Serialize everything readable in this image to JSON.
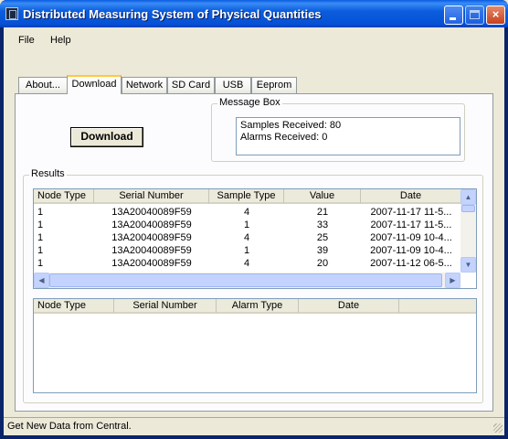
{
  "window": {
    "title": "Distributed Measuring System of Physical Quantities",
    "minimize_glyph": "",
    "close_glyph": "×"
  },
  "menu": [
    {
      "label": "File"
    },
    {
      "label": "Help"
    }
  ],
  "tabs": [
    {
      "label": "About..."
    },
    {
      "label": "Download",
      "active": true
    },
    {
      "label": "Network"
    },
    {
      "label": "SD Card"
    },
    {
      "label": "USB"
    },
    {
      "label": "Eeprom"
    }
  ],
  "download": {
    "button_label": "Download"
  },
  "message_box": {
    "label": "Message Box",
    "lines": [
      "Samples Received: 80",
      "Alarms Received: 0"
    ]
  },
  "results": {
    "label": "Results",
    "samples_table": {
      "columns": [
        "Node Type",
        "Serial Number",
        "Sample Type",
        "Value",
        "Date"
      ],
      "rows": [
        [
          "1",
          "13A20040089F59",
          "4",
          "21",
          "2007-11-17 11-5..."
        ],
        [
          "1",
          "13A20040089F59",
          "1",
          "33",
          "2007-11-17 11-5..."
        ],
        [
          "1",
          "13A20040089F59",
          "4",
          "25",
          "2007-11-09 10-4..."
        ],
        [
          "1",
          "13A20040089F59",
          "1",
          "39",
          "2007-11-09 10-4..."
        ],
        [
          "1",
          "13A20040089F59",
          "4",
          "20",
          "2007-11-12 06-5..."
        ]
      ]
    },
    "alarms_table": {
      "columns": [
        "Node Type",
        "Serial Number",
        "Alarm Type",
        "Date",
        ""
      ],
      "rows": []
    }
  },
  "status_bar": {
    "text": "Get New Data from Central."
  },
  "colors": {
    "titlebar": "#0a5be0",
    "dialog_bg": "#ece9d8",
    "panel_bg": "#fcfcfe",
    "tab_highlight": "#ffc83c"
  }
}
